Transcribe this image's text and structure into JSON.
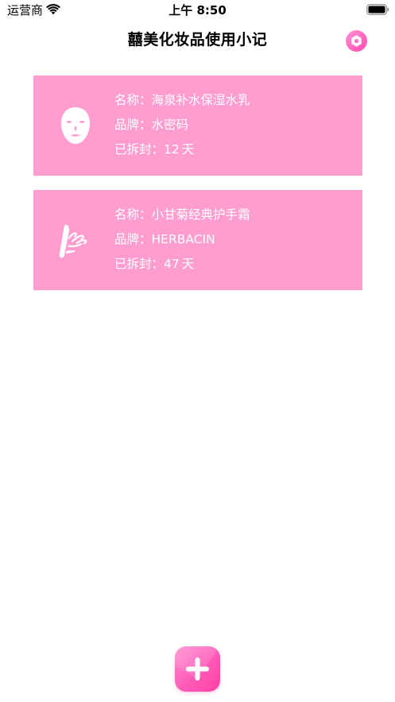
{
  "status_bar": {
    "carrier": "运营商",
    "time": "上午 8:50"
  },
  "header": {
    "title": "囍美化妆品使用小记",
    "settings_icon": "hexagon-gear-icon"
  },
  "products": [
    {
      "icon": "face-mask-icon",
      "name_label": "名称：",
      "name": "海泉补水保湿水乳",
      "brand_label": "品牌：",
      "brand": "水密码",
      "opened_label": "已拆封：",
      "opened_days": "12",
      "days_unit": "天"
    },
    {
      "icon": "hand-cream-icon",
      "name_label": "名称：",
      "name": "小甘菊经典护手霜",
      "brand_label": "品牌：",
      "brand": "HERBACIN",
      "opened_label": "已拆封：",
      "opened_days": "47",
      "days_unit": "天"
    }
  ],
  "add_button": {
    "icon": "plus-icon"
  },
  "colors": {
    "card_background": "#ff9dd0",
    "accent": "#ff5ab8",
    "card_text": "#ffffff"
  }
}
